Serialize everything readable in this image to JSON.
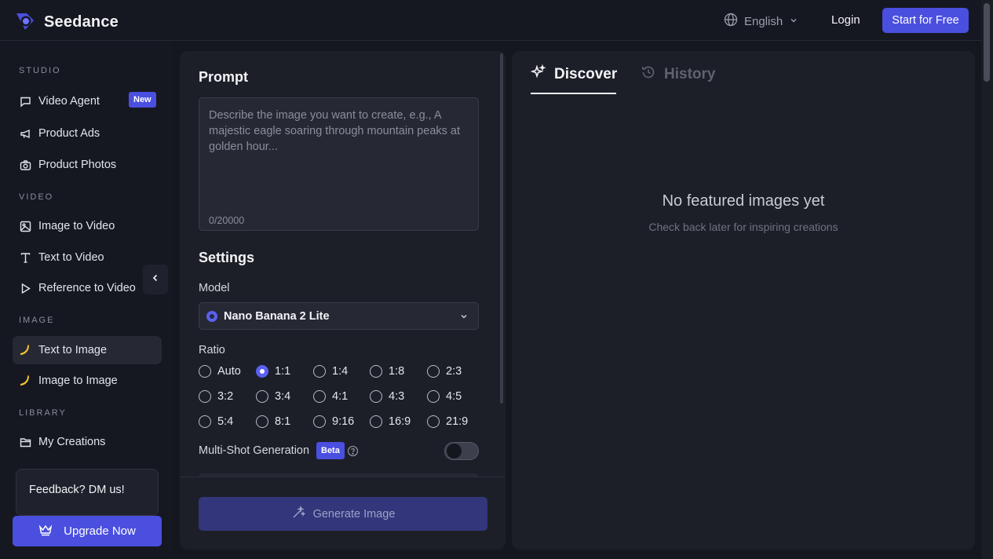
{
  "header": {
    "brand": "Seedance",
    "language": "English",
    "login": "Login",
    "start_free": "Start for Free"
  },
  "sidebar": {
    "sections": {
      "studio": "STUDIO",
      "video": "VIDEO",
      "image": "IMAGE",
      "library": "LIBRARY"
    },
    "items": {
      "video_agent": "Video Agent",
      "video_agent_badge": "New",
      "product_ads": "Product Ads",
      "product_photos": "Product Photos",
      "image_to_video": "Image to Video",
      "text_to_video": "Text to Video",
      "reference_to_video": "Reference to Video",
      "text_to_image": "Text to Image",
      "image_to_image": "Image to Image",
      "my_creations": "My Creations"
    },
    "active_item": "text_to_image",
    "feedback": "Feedback? DM us!",
    "upgrade": "Upgrade Now"
  },
  "form": {
    "prompt_title": "Prompt",
    "prompt_placeholder": "Describe the image you want to create, e.g., A majestic eagle soaring through mountain peaks at golden hour...",
    "prompt_value": "",
    "counter": "0/20000",
    "settings_title": "Settings",
    "model_label": "Model",
    "model_value": "Nano Banana 2 Lite",
    "ratio_label": "Ratio",
    "ratios": [
      "Auto",
      "1:1",
      "1:4",
      "1:8",
      "2:3",
      "3:2",
      "3:4",
      "4:1",
      "4:3",
      "4:5",
      "5:4",
      "8:1",
      "9:16",
      "16:9",
      "21:9"
    ],
    "selected_ratio": "1:1",
    "multishot_label": "Multi-Shot Generation",
    "multishot_badge": "Beta",
    "multishot_enabled": false,
    "generate": "Generate Image"
  },
  "discover": {
    "tabs": {
      "discover": "Discover",
      "history": "History"
    },
    "active_tab": "discover",
    "empty_title": "No featured images yet",
    "empty_subtitle": "Check back later for inspiring creations"
  },
  "colors": {
    "accent": "#4a4fe0",
    "background": "#15171f",
    "panel": "#1d1f28"
  }
}
